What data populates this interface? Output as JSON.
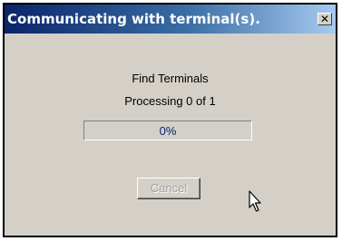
{
  "window": {
    "title": "Communicating with terminal(s).",
    "close_glyph": "✕"
  },
  "dialog": {
    "heading": "Find Terminals",
    "status": "Processing 0 of 1"
  },
  "progress": {
    "label": "0%",
    "value_percent": 0
  },
  "buttons": {
    "cancel_label": "Cancel",
    "cancel_enabled": false
  },
  "colors": {
    "title_start": "#0a246a",
    "title_end": "#a6caf0",
    "face": "#d4d0c8",
    "progress_text": "#0a246a"
  },
  "icons": {
    "close": "close-icon",
    "cursor": "mouse-pointer-icon"
  }
}
